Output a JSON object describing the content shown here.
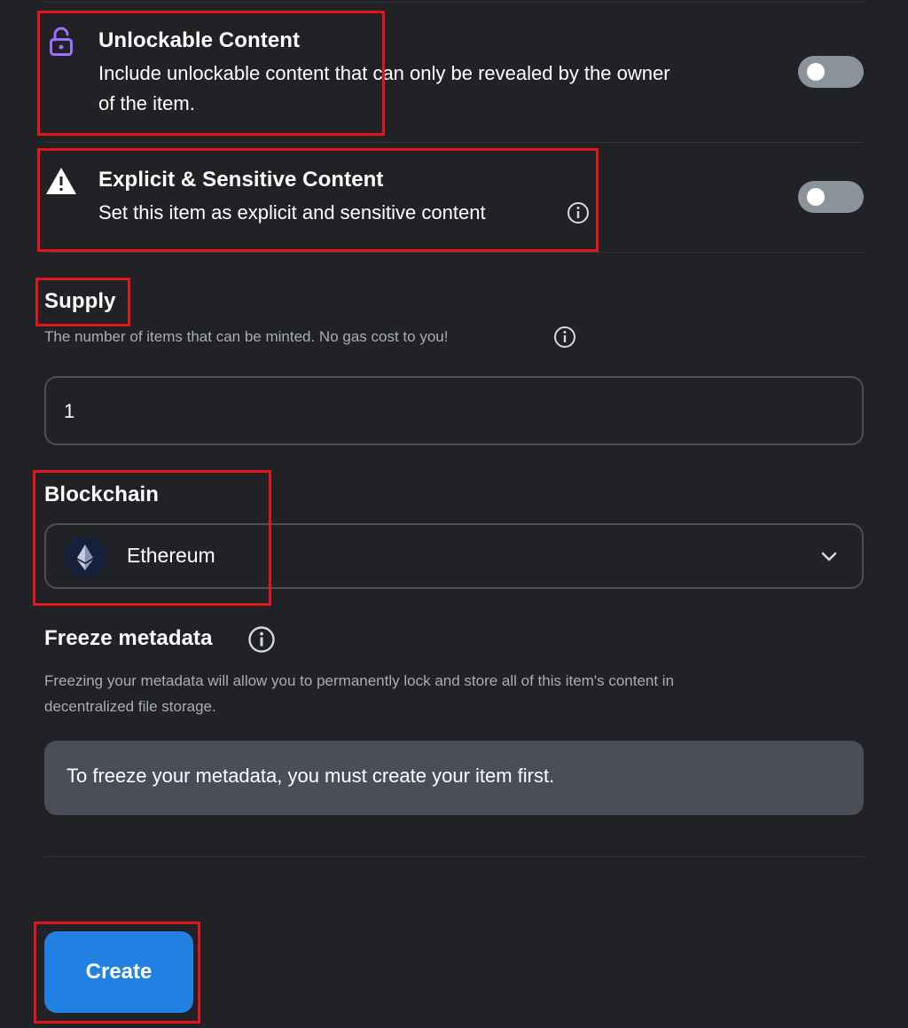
{
  "unlockable": {
    "title": "Unlockable Content",
    "description_line1": "Include unlockable content that can only be revealed by the owner",
    "description_line2": "of the item.",
    "toggle_on": false,
    "icon": "lock-open-icon",
    "icon_color": "#9b6fff"
  },
  "explicit": {
    "title": "Explicit & Sensitive Content",
    "description": "Set this item as explicit and sensitive content",
    "toggle_on": false,
    "icon": "warning-icon"
  },
  "supply": {
    "title": "Supply",
    "description": "The number of items that can be minted. No gas cost to you!",
    "value": "1"
  },
  "blockchain": {
    "title": "Blockchain",
    "selected": "Ethereum",
    "icon": "ethereum-icon"
  },
  "freeze": {
    "title": "Freeze metadata",
    "description_line1": "Freezing your metadata will allow you to permanently lock and store all of this item's content in",
    "description_line2": "decentralized file storage.",
    "notice": "To freeze your metadata, you must create your item first."
  },
  "actions": {
    "create_label": "Create",
    "primary_color": "#2081e2"
  },
  "annotation": {
    "highlight_color": "#e3141b"
  }
}
